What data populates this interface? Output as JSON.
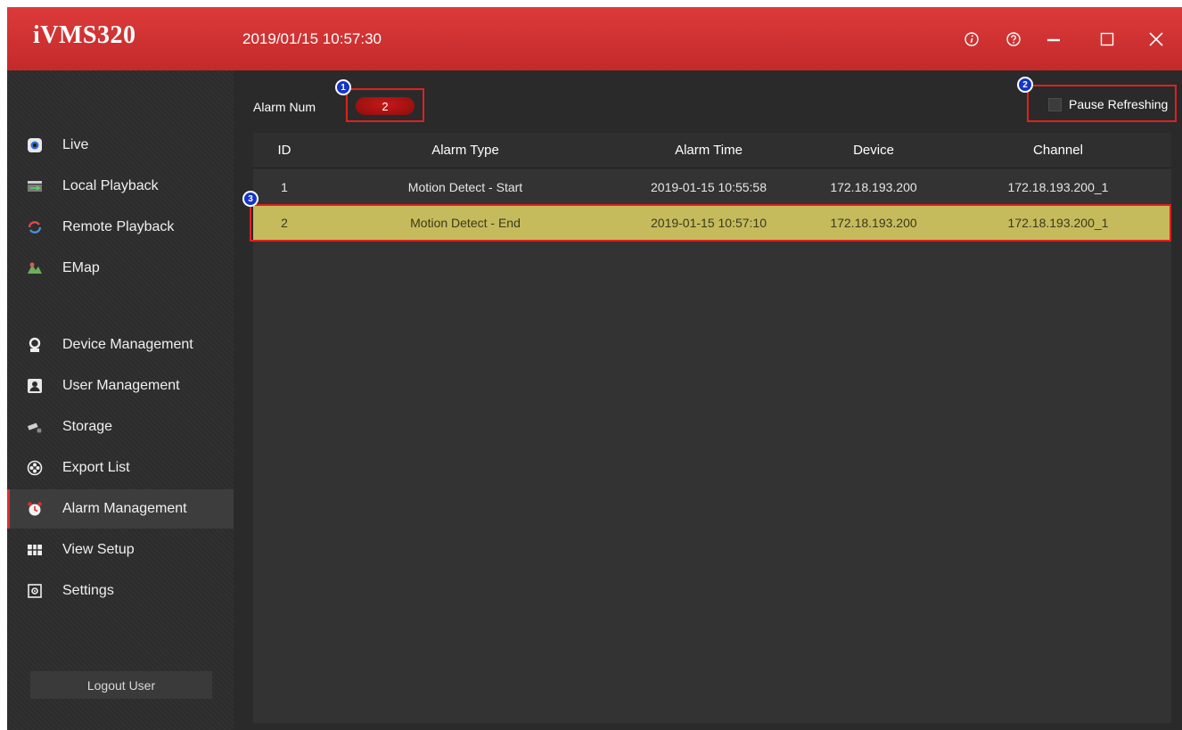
{
  "app": {
    "logo": "iVMS320",
    "datetime": "2019/01/15 10:57:30",
    "window_buttons": [
      {
        "icon": "info-icon"
      },
      {
        "icon": "help-icon"
      },
      {
        "icon": "minimize-icon"
      },
      {
        "icon": "maximize-icon"
      },
      {
        "icon": "close-icon"
      }
    ]
  },
  "sidebar": {
    "items": [
      {
        "label": "Live",
        "icon": "live-icon"
      },
      {
        "label": "Local Playback",
        "icon": "local-playback-icon"
      },
      {
        "label": "Remote Playback",
        "icon": "remote-playback-icon"
      },
      {
        "label": "EMap",
        "icon": "emap-icon"
      },
      {
        "label": "Device Management",
        "icon": "device-management-icon"
      },
      {
        "label": "User Management",
        "icon": "user-management-icon"
      },
      {
        "label": "Storage",
        "icon": "storage-icon"
      },
      {
        "label": "Export List",
        "icon": "export-list-icon"
      },
      {
        "label": "Alarm Management",
        "icon": "alarm-clock-icon",
        "active": true
      },
      {
        "label": "View Setup",
        "icon": "view-setup-icon"
      },
      {
        "label": "Settings",
        "icon": "settings-icon"
      }
    ],
    "logout_label": "Logout User"
  },
  "main": {
    "alarm_num_label": "Alarm Num",
    "alarm_num_value": "2",
    "pause_refreshing_label": "Pause Refreshing",
    "pause_refreshing_checked": false,
    "badges": [
      "1",
      "2",
      "3"
    ],
    "table": {
      "headers": {
        "id": "ID",
        "type": "Alarm Type",
        "time": "Alarm Time",
        "device": "Device",
        "channel": "Channel"
      },
      "rows": [
        {
          "id": "1",
          "type": "Motion Detect - Start",
          "time": "2019-01-15 10:55:58",
          "device": "172.18.193.200",
          "channel": "172.18.193.200_1"
        },
        {
          "id": "2",
          "type": "Motion Detect - End",
          "time": "2019-01-15 10:57:10",
          "device": "172.18.193.200",
          "channel": "172.18.193.200_1",
          "selected": true
        }
      ]
    }
  },
  "colors": {
    "titlebar": "#d23333",
    "highlight_box": "#e02020",
    "selected_row": "#c6bb5c",
    "badge": "#1435c8"
  }
}
